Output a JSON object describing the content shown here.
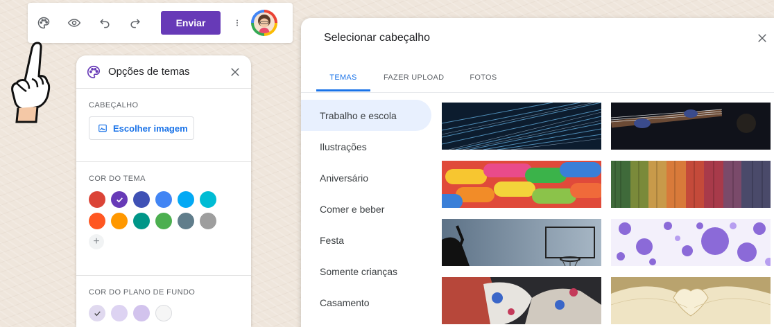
{
  "toolbar": {
    "icons": [
      "palette-icon",
      "eye-icon",
      "undo-icon",
      "redo-icon",
      "more-vert-icon"
    ],
    "send_label": "Enviar",
    "accent": "#673ab7"
  },
  "theme_panel": {
    "title": "Opções de temas",
    "header_section_label": "CABEÇALHO",
    "choose_image_label": "Escolher imagem",
    "theme_color_label": "COR DO TEMA",
    "theme_colors": [
      "#db4437",
      "#673ab7",
      "#3f51b5",
      "#4285f4",
      "#03a9f4",
      "#00bcd4",
      "#ff5722",
      "#ff9800",
      "#009688",
      "#4caf50",
      "#607d8b",
      "#9e9e9e"
    ],
    "selected_theme_color": "#673ab7",
    "background_color_label": "COR DO PLANO DE FUNDO",
    "background_colors": [
      "#e0d9ef",
      "#ddd3f2",
      "#d2c3ed",
      "#f6f6f6"
    ]
  },
  "dialog": {
    "title": "Selecionar cabeçalho",
    "tabs": [
      "TEMAS",
      "FAZER UPLOAD",
      "FOTOS"
    ],
    "active_tab": "TEMAS",
    "categories": [
      "Trabalho e escola",
      "Ilustrações",
      "Aniversário",
      "Comer e beber",
      "Festa",
      "Somente crianças",
      "Casamento"
    ],
    "active_category": "Trabalho e escola",
    "thumbnails": [
      "fiber-optics-photo",
      "guitar-photo",
      "candy-photo",
      "yarn-photo",
      "basketball-hoop-photo",
      "purple-bubbles-photo",
      "painted-hands-photo",
      "book-pages-heart-photo"
    ]
  }
}
